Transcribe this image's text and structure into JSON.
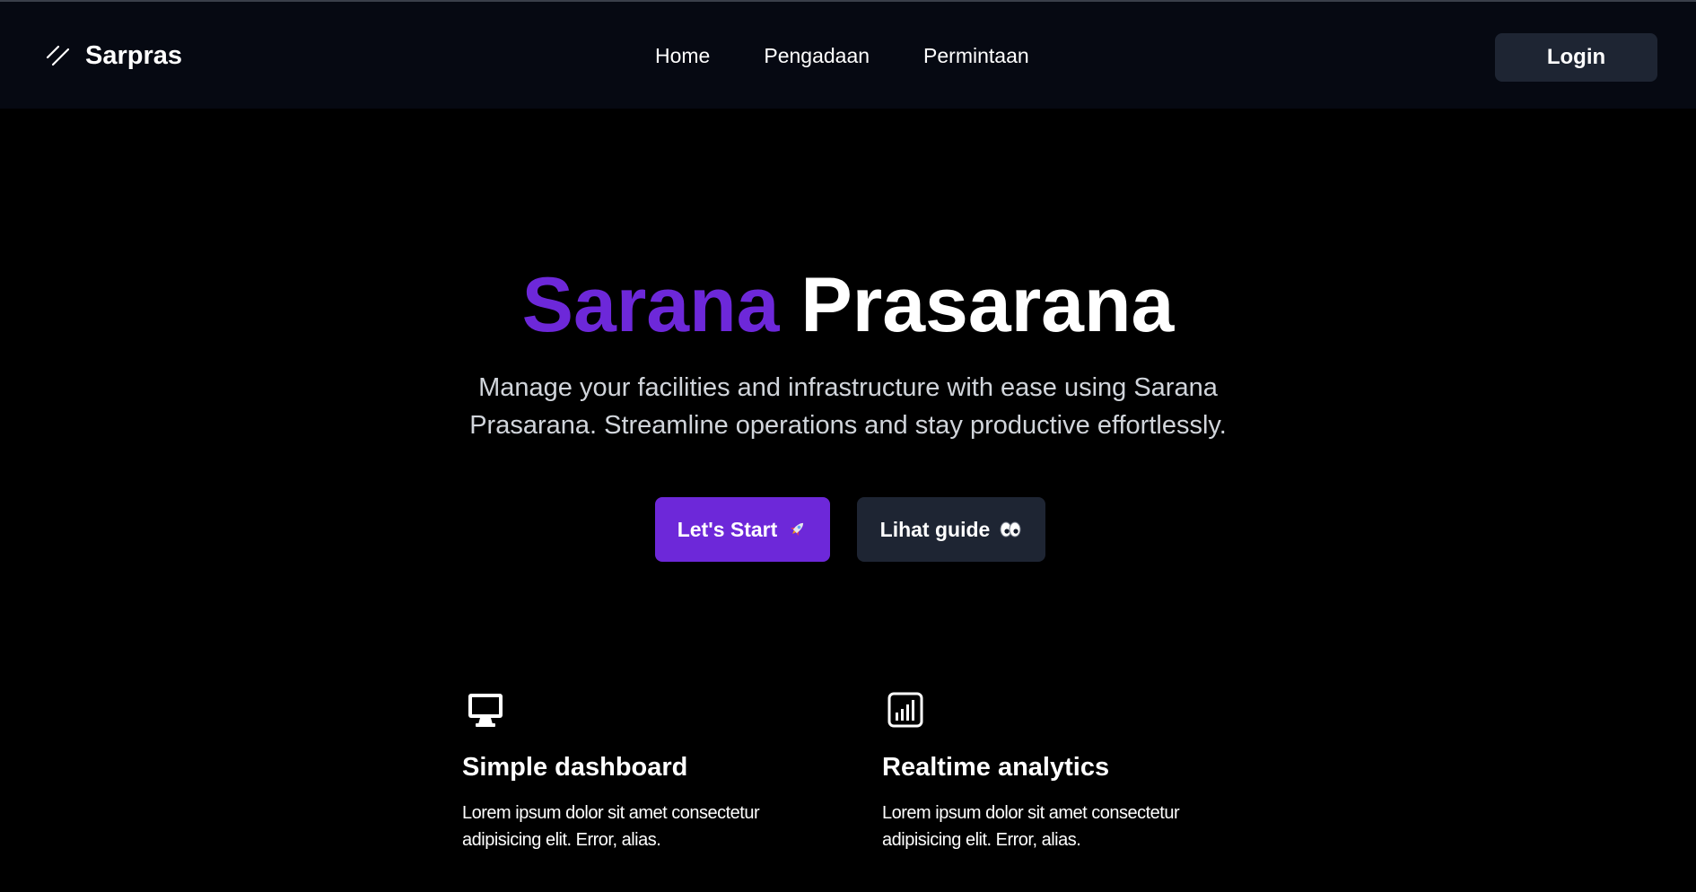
{
  "navbar": {
    "brand": {
      "name": "Sarpras",
      "icon": "slash-logo-icon"
    },
    "links": [
      {
        "label": "Home"
      },
      {
        "label": "Pengadaan"
      },
      {
        "label": "Permintaan"
      }
    ],
    "login_label": "Login"
  },
  "hero": {
    "title_accent": "Sarana",
    "title_rest": "Prasarana",
    "subtitle": "Manage your facilities and infrastructure with ease using Sarana Prasarana. Streamline operations and stay productive effortlessly.",
    "primary_button": {
      "label": "Let's Start",
      "icon": "rocket-icon"
    },
    "secondary_button": {
      "label": "Lihat guide",
      "icon": "eyes-icon"
    }
  },
  "features": [
    {
      "icon": "monitor-icon",
      "title": "Simple dashboard",
      "description": "Lorem ipsum dolor sit amet consectetur adipisicing elit. Error, alias."
    },
    {
      "icon": "analytics-chart-icon",
      "title": "Realtime analytics",
      "description": "Lorem ipsum dolor sit amet consectetur adipisicing elit. Error, alias."
    }
  ],
  "colors": {
    "accent": "#6d28d9",
    "navbar_bg": "#060912",
    "button_dark": "#1e2533",
    "page_bg": "#000000"
  }
}
